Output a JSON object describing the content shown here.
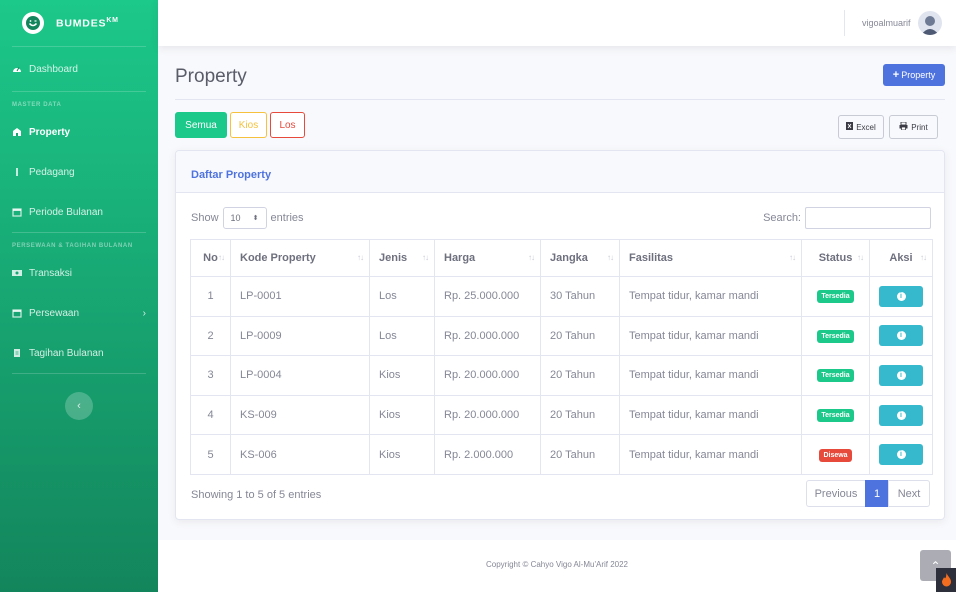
{
  "brand": {
    "name": "BUMDES",
    "sup": "KM"
  },
  "sidebar": {
    "dashboard": "Dashboard",
    "heading_master": "MASTER DATA",
    "property": "Property",
    "pedagang": "Pedagang",
    "periode": "Periode Bulanan",
    "heading_sewa": "PERSEWAAN & TAGIHAN BULANAN",
    "transaksi": "Transaksi",
    "persewaan": "Persewaan",
    "tagihan": "Tagihan Bulanan"
  },
  "topbar": {
    "username": "vigoalmuarif"
  },
  "page": {
    "title": "Property",
    "add_button": "Property"
  },
  "filters": {
    "semua": "Semua",
    "kios": "Kios",
    "los": "Los"
  },
  "export": {
    "excel": "Excel",
    "print": "Print"
  },
  "card": {
    "title": "Daftar Property"
  },
  "table_controls": {
    "show": "Show",
    "entries_value": "10",
    "entries": "entries",
    "search_label": "Search:"
  },
  "table": {
    "headers": [
      "No",
      "Kode Property",
      "Jenis",
      "Harga",
      "Jangka",
      "Fasilitas",
      "Status",
      "Aksi"
    ],
    "rows": [
      {
        "no": "1",
        "kode": "LP-0001",
        "jenis": "Los",
        "harga": "Rp. 25.000.000",
        "jangka": "30 Tahun",
        "fasilitas": "Tempat tidur, kamar mandi",
        "status": "Tersedia"
      },
      {
        "no": "2",
        "kode": "LP-0009",
        "jenis": "Los",
        "harga": "Rp. 20.000.000",
        "jangka": "20 Tahun",
        "fasilitas": "Tempat tidur, kamar mandi",
        "status": "Tersedia"
      },
      {
        "no": "3",
        "kode": "LP-0004",
        "jenis": "Kios",
        "harga": "Rp. 20.000.000",
        "jangka": "20 Tahun",
        "fasilitas": "Tempat tidur, kamar mandi",
        "status": "Tersedia"
      },
      {
        "no": "4",
        "kode": "KS-009",
        "jenis": "Kios",
        "harga": "Rp. 20.000.000",
        "jangka": "20 Tahun",
        "fasilitas": "Tempat tidur, kamar mandi",
        "status": "Tersedia"
      },
      {
        "no": "5",
        "kode": "KS-006",
        "jenis": "Kios",
        "harga": "Rp. 2.000.000",
        "jangka": "20 Tahun",
        "fasilitas": "Tempat tidur, kamar mandi",
        "status": "Disewa"
      }
    ]
  },
  "info": "Showing 1 to 5 of 5 entries",
  "pagination": {
    "previous": "Previous",
    "page": "1",
    "next": "Next"
  },
  "footer": "Copyright © Cahyo Vigo Al-Mu'Arif 2022",
  "colors": {
    "primary": "#4e73df",
    "success": "#1cc88a",
    "warning": "#f6c23e",
    "danger": "#e74a3b",
    "info": "#36b9cc"
  }
}
